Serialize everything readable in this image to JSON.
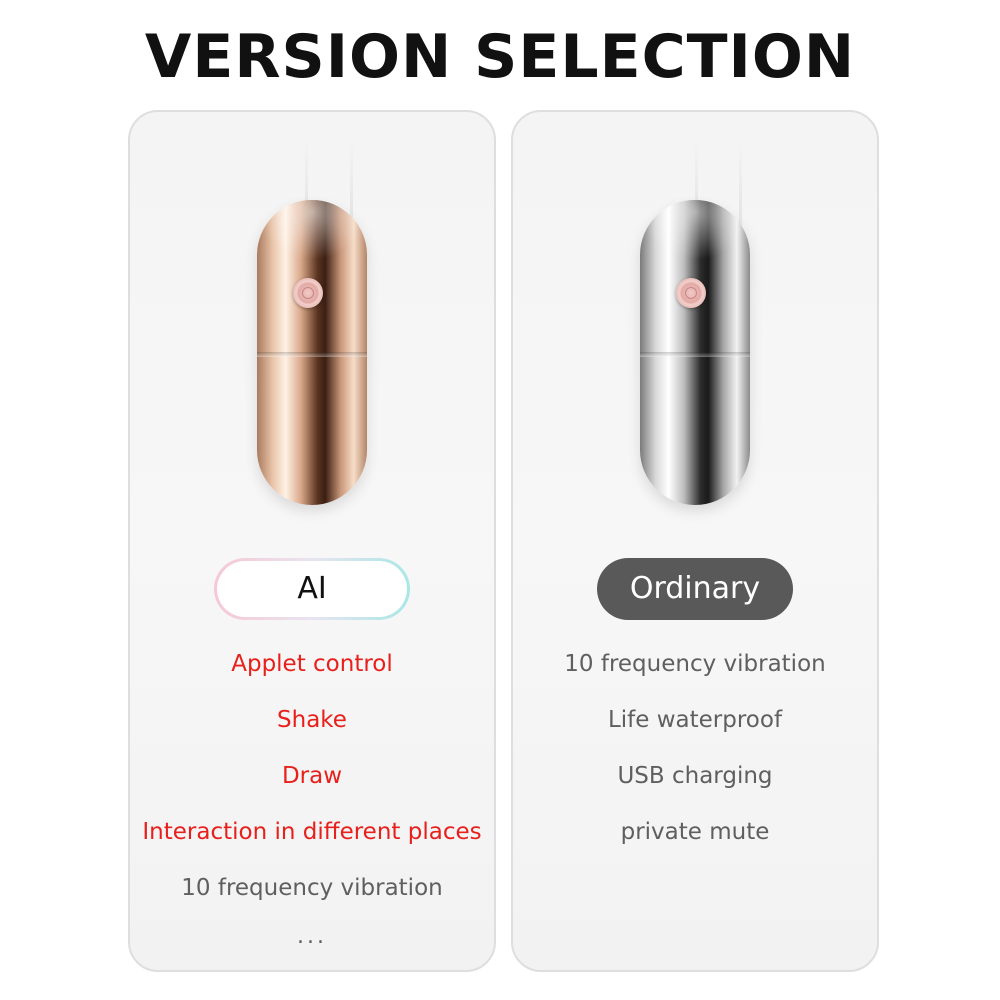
{
  "title": "VERSION SELECTION",
  "colors": {
    "highlight_text": "#e8201c",
    "body_text": "#5f5f5f",
    "ordinary_pill": "#595959",
    "ai_pill_gradient": [
      "#f6c8d4",
      "#a9e7e6"
    ]
  },
  "versions": [
    {
      "label": "AI",
      "product_finish": "rose-gold",
      "features": [
        {
          "text": "Applet control",
          "highlight": true
        },
        {
          "text": "Shake",
          "highlight": true
        },
        {
          "text": "Draw",
          "highlight": true
        },
        {
          "text": "Interaction in different places",
          "highlight": true
        },
        {
          "text": "10 frequency vibration",
          "highlight": false
        }
      ],
      "more": "..."
    },
    {
      "label": "Ordinary",
      "product_finish": "silver",
      "features": [
        {
          "text": "10 frequency vibration",
          "highlight": false
        },
        {
          "text": "Life waterproof",
          "highlight": false
        },
        {
          "text": "USB charging",
          "highlight": false
        },
        {
          "text": "private mute",
          "highlight": false
        }
      ]
    }
  ]
}
